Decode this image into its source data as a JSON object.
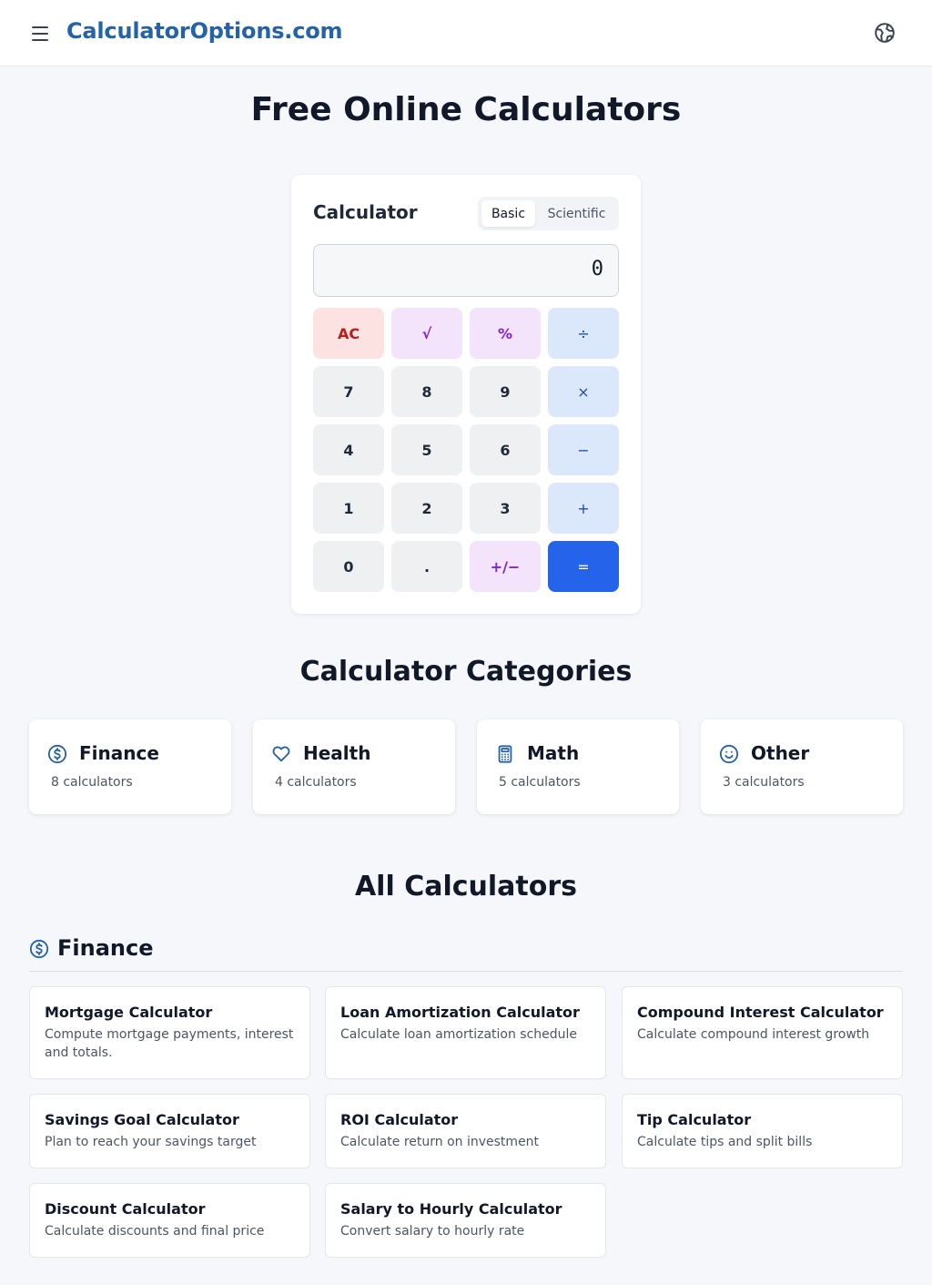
{
  "header": {
    "logo": "CalculatorOptions.com",
    "menu_icon": "hamburger-menu-icon",
    "language_icon": "globe-icon"
  },
  "hero": {
    "title": "Free Online Calculators"
  },
  "calculator": {
    "title": "Calculator",
    "modes": [
      "Basic",
      "Scientific"
    ],
    "active_mode": "Basic",
    "display": "0",
    "keys": [
      [
        "AC",
        "√",
        "%",
        "÷"
      ],
      [
        "7",
        "8",
        "9",
        "×"
      ],
      [
        "4",
        "5",
        "6",
        "−"
      ],
      [
        "1",
        "2",
        "3",
        "+"
      ],
      [
        "0",
        ".",
        "+/−",
        "="
      ]
    ],
    "colors": {
      "equals": "#2563eb",
      "clear": "#fde2e2",
      "function": "#f3e3fb",
      "operator": "#dbe8fc",
      "number": "#eff0f2"
    }
  },
  "categories_section": {
    "title": "Calculator Categories",
    "items": [
      {
        "name": "Finance",
        "count": "8 calculators",
        "icon": "dollar-circle-icon"
      },
      {
        "name": "Health",
        "count": "4 calculators",
        "icon": "heart-icon"
      },
      {
        "name": "Math",
        "count": "5 calculators",
        "icon": "calculator-icon"
      },
      {
        "name": "Other",
        "count": "3 calculators",
        "icon": "smiley-icon"
      }
    ]
  },
  "all_section": {
    "title": "All Calculators",
    "finance": {
      "title": "Finance",
      "icon": "dollar-circle-icon",
      "items": [
        {
          "title": "Mortgage Calculator",
          "desc": "Compute mortgage payments, interest and totals."
        },
        {
          "title": "Loan Amortization Calculator",
          "desc": "Calculate loan amortization schedule"
        },
        {
          "title": "Compound Interest Calculator",
          "desc": "Calculate compound interest growth"
        },
        {
          "title": "Savings Goal Calculator",
          "desc": "Plan to reach your savings target"
        },
        {
          "title": "ROI Calculator",
          "desc": "Calculate return on investment"
        },
        {
          "title": "Tip Calculator",
          "desc": "Calculate tips and split bills"
        },
        {
          "title": "Discount Calculator",
          "desc": "Calculate discounts and final price"
        },
        {
          "title": "Salary to Hourly Calculator",
          "desc": "Convert salary to hourly rate"
        }
      ]
    }
  },
  "brand_color": "#2563a8"
}
